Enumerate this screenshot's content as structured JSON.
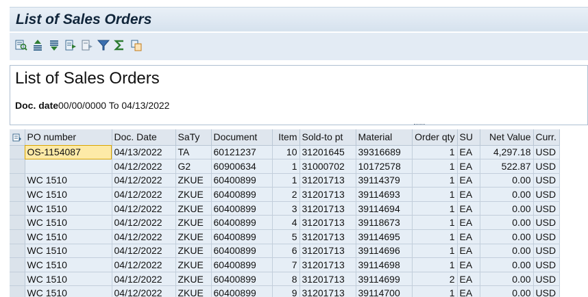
{
  "window": {
    "title": "List of Sales Orders"
  },
  "toolbar": {
    "icons": [
      "details-icon",
      "sort-ascending-icon",
      "sort-descending-icon",
      "export-icon",
      "print-icon",
      "filter-icon",
      "sum-icon",
      "layout-icon"
    ]
  },
  "header": {
    "title": "List of Sales Orders",
    "doc_date_label": "Doc. date",
    "doc_date_value": "00/00/0000 To 04/13/2022"
  },
  "table": {
    "columns": [
      "PO number",
      "Doc. Date",
      "SaTy",
      "Document",
      "Item",
      "Sold-to pt",
      "Material",
      "Order qty",
      "SU",
      "Net Value",
      "Curr."
    ],
    "rows": [
      [
        "OS-1154087",
        "04/13/2022",
        "TA",
        "60121237",
        "10",
        "31201645",
        "39316689",
        "1",
        "EA",
        "4,297.18",
        "USD"
      ],
      [
        "",
        "04/12/2022",
        "G2",
        "60900634",
        "1",
        "31000702",
        "10172578",
        "1",
        "EA",
        "522.87",
        "USD"
      ],
      [
        "WC 1510",
        "04/12/2022",
        "ZKUE",
        "60400899",
        "1",
        "31201713",
        "39114379",
        "1",
        "EA",
        "0.00",
        "USD"
      ],
      [
        "WC 1510",
        "04/12/2022",
        "ZKUE",
        "60400899",
        "2",
        "31201713",
        "39114693",
        "1",
        "EA",
        "0.00",
        "USD"
      ],
      [
        "WC 1510",
        "04/12/2022",
        "ZKUE",
        "60400899",
        "3",
        "31201713",
        "39114694",
        "1",
        "EA",
        "0.00",
        "USD"
      ],
      [
        "WC 1510",
        "04/12/2022",
        "ZKUE",
        "60400899",
        "4",
        "31201713",
        "39118673",
        "1",
        "EA",
        "0.00",
        "USD"
      ],
      [
        "WC 1510",
        "04/12/2022",
        "ZKUE",
        "60400899",
        "5",
        "31201713",
        "39114695",
        "1",
        "EA",
        "0.00",
        "USD"
      ],
      [
        "WC 1510",
        "04/12/2022",
        "ZKUE",
        "60400899",
        "6",
        "31201713",
        "39114696",
        "1",
        "EA",
        "0.00",
        "USD"
      ],
      [
        "WC 1510",
        "04/12/2022",
        "ZKUE",
        "60400899",
        "7",
        "31201713",
        "39114698",
        "1",
        "EA",
        "0.00",
        "USD"
      ],
      [
        "WC 1510",
        "04/12/2022",
        "ZKUE",
        "60400899",
        "8",
        "31201713",
        "39114699",
        "2",
        "EA",
        "0.00",
        "USD"
      ],
      [
        "WC 1510",
        "04/12/2022",
        "ZKUE",
        "60400899",
        "9",
        "31201713",
        "39114700",
        "1",
        "EA",
        "0.00",
        "USD"
      ]
    ]
  }
}
